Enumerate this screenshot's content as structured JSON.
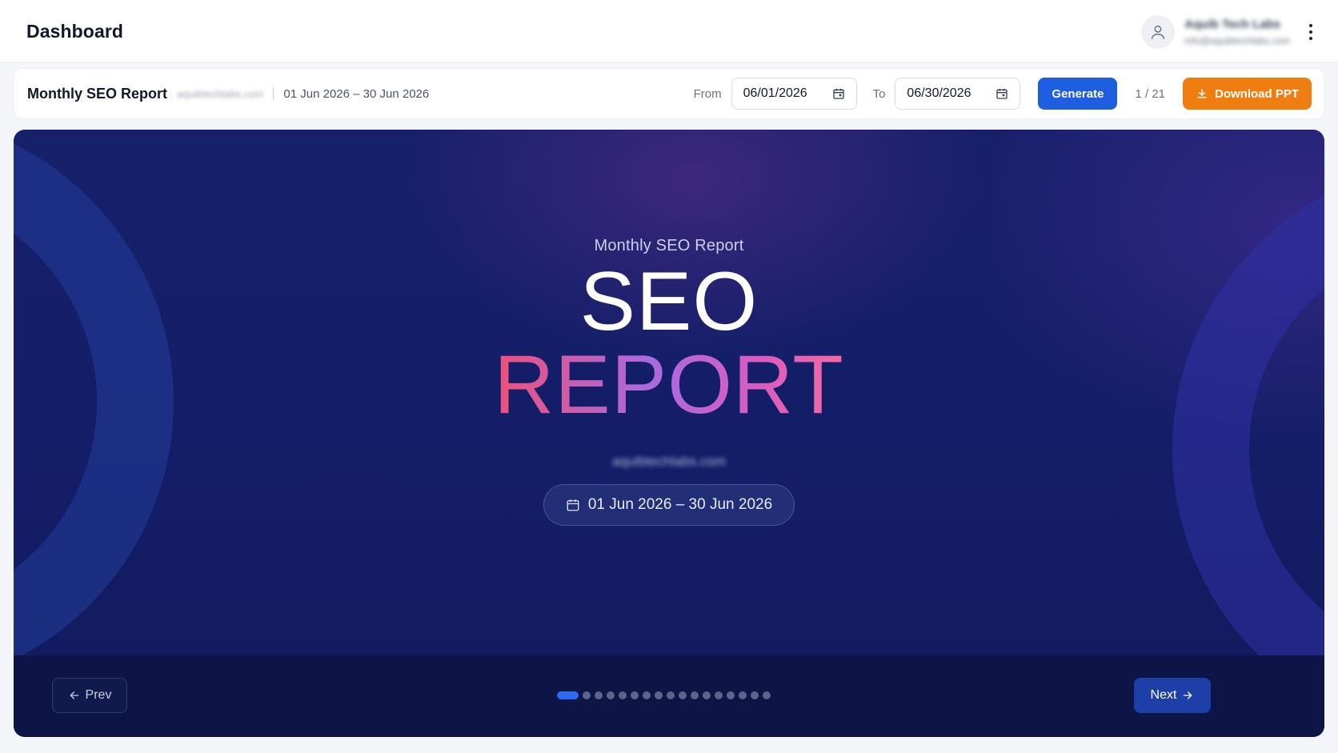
{
  "header": {
    "title": "Dashboard",
    "user": {
      "name": "Aquib Tech Labs",
      "email": "info@aquibtechlabs.com"
    }
  },
  "toolbar": {
    "report_title": "Monthly SEO Report",
    "domain": "aquibtechlabs.com",
    "date_range": "01 Jun 2026 – 30 Jun 2026",
    "from_label": "From",
    "from_value": "06/01/2026",
    "to_label": "To",
    "to_value": "06/30/2026",
    "generate_label": "Generate",
    "page_indicator": "1 / 21",
    "download_label": "Download PPT"
  },
  "slide": {
    "subtitle": "Monthly SEO Report",
    "title_line1": "SEO",
    "title_line2": "REPORT",
    "domain": "aquibtechlabs.com",
    "date_range": "01 Jun 2026 – 30 Jun 2026"
  },
  "navigation": {
    "prev_label": "Prev",
    "next_label": "Next",
    "dot_count": 17,
    "active_dot": 0
  },
  "colors": {
    "primary": "#1d5fe0",
    "download": "#f07d10",
    "slide_bg": "#141e68",
    "active_dot": "#2f6bf0"
  },
  "icons": [
    "user-icon",
    "more-vertical-icon",
    "calendar-icon",
    "download-icon",
    "arrow-left-icon",
    "arrow-right-icon"
  ]
}
